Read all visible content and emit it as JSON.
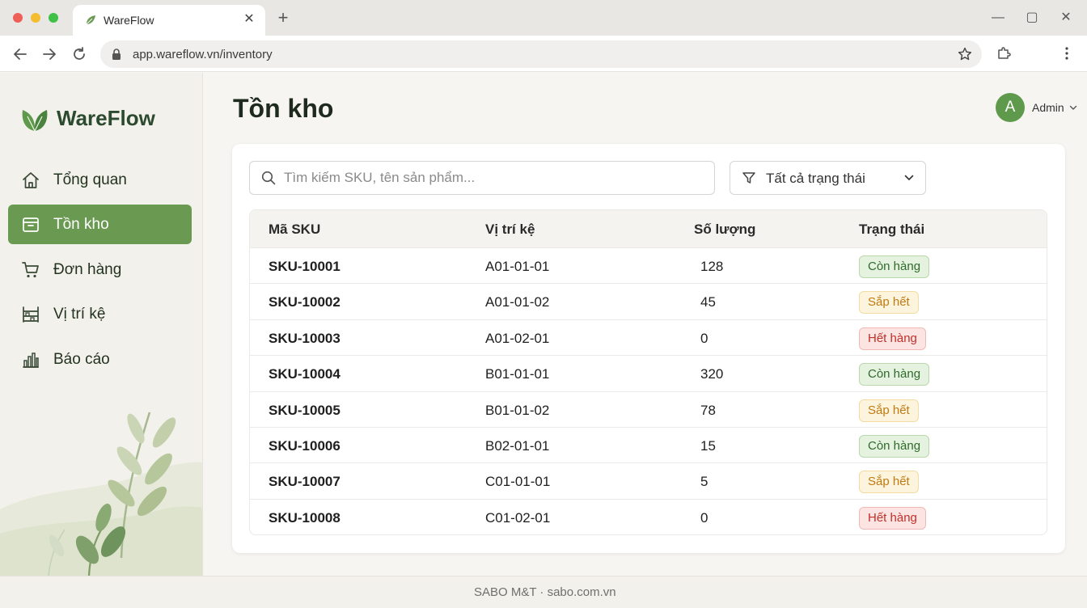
{
  "browser": {
    "tab_title": "WareFlow",
    "url": "app.wareflow.vn/inventory"
  },
  "sidebar": {
    "brand": "WareFlow",
    "items": [
      {
        "label": "Tổng quan",
        "icon": "home-icon"
      },
      {
        "label": "Tồn kho",
        "icon": "box-icon",
        "active": true
      },
      {
        "label": "Đơn hàng",
        "icon": "cart-icon"
      },
      {
        "label": "Vị trí kệ",
        "icon": "shelf-icon"
      },
      {
        "label": "Báo cáo",
        "icon": "bar-chart-icon"
      }
    ]
  },
  "header": {
    "title": "Tồn kho",
    "user_initial": "A",
    "user_name": "Admin"
  },
  "filters": {
    "search_placeholder": "Tìm kiếm SKU, tên sản phẩm...",
    "status_selected": "Tất cả trạng thái"
  },
  "table": {
    "columns": [
      "Mã SKU",
      "Vị trí kệ",
      "Số lượng",
      "Trạng thái"
    ],
    "rows": [
      {
        "sku": "SKU-10001",
        "location": "A01-01-01",
        "qty": "128",
        "status": "Còn hàng",
        "tone": "in"
      },
      {
        "sku": "SKU-10002",
        "location": "A01-01-02",
        "qty": "45",
        "status": "Sắp hết",
        "tone": "low"
      },
      {
        "sku": "SKU-10003",
        "location": "A01-02-01",
        "qty": "0",
        "status": "Hết hàng",
        "tone": "out"
      },
      {
        "sku": "SKU-10004",
        "location": "B01-01-01",
        "qty": "320",
        "status": "Còn hàng",
        "tone": "in"
      },
      {
        "sku": "SKU-10005",
        "location": "B01-01-02",
        "qty": "78",
        "status": "Sắp hết",
        "tone": "low"
      },
      {
        "sku": "SKU-10006",
        "location": "B02-01-01",
        "qty": "15",
        "status": "Còn hàng",
        "tone": "in"
      },
      {
        "sku": "SKU-10007",
        "location": "C01-01-01",
        "qty": "5",
        "status": "Sắp hết",
        "tone": "low"
      },
      {
        "sku": "SKU-10008",
        "location": "C01-02-01",
        "qty": "0",
        "status": "Hết hàng",
        "tone": "out"
      }
    ]
  },
  "footer": {
    "text": "SABO M&T · sabo.com.vn"
  },
  "colors": {
    "accent": "#6a9a52",
    "brand_text": "#2c4a2e",
    "in_stock": "#2e6b2a",
    "low_stock": "#c07a12",
    "out_of_stock": "#c0302a"
  }
}
